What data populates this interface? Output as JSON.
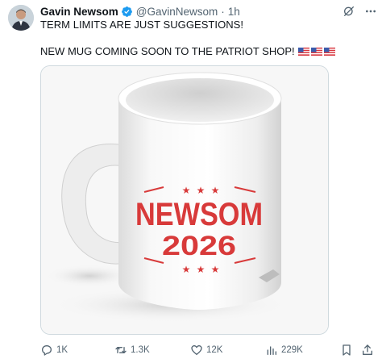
{
  "author": {
    "name": "Gavin Newsom",
    "handle": "@GavinNewsom",
    "separator": "·",
    "time": "1h",
    "verified_color": "#1d9bf0"
  },
  "tweet": {
    "line1": "TERM LIMITS ARE JUST SUGGESTIONS!",
    "line2": "NEW MUG COMING SOON TO THE PATRIOT SHOP!",
    "flag_count": 3
  },
  "media": {
    "mug_line1": "NEWSOM",
    "mug_line2": "2026",
    "print_color": "#d83a3a"
  },
  "actions": {
    "replies": "1K",
    "reposts": "1.3K",
    "likes": "12K",
    "views": "229K"
  },
  "icons": [
    "verified-badge-icon",
    "grok-icon",
    "more-icon",
    "reply-icon",
    "repost-icon",
    "like-icon",
    "views-icon",
    "bookmark-icon",
    "share-icon"
  ]
}
